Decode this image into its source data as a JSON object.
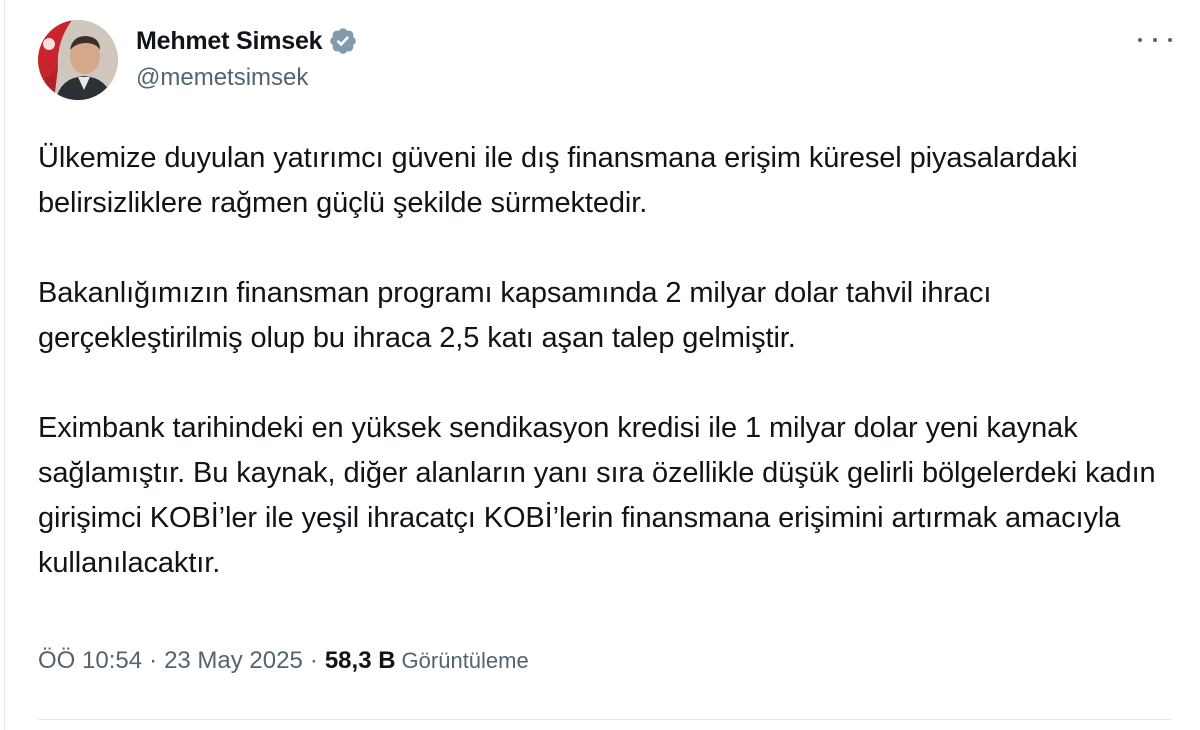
{
  "author": {
    "display_name": "Mehmet Simsek",
    "handle": "@memetsimsek",
    "verified": true,
    "avatar_icon": "profile-photo"
  },
  "more_icon": "more-horizontal-icon",
  "tweet": {
    "paragraphs": [
      "Ülkemize duyulan yatırımcı güveni ile dış finansmana erişim küresel piyasalardaki belirsizliklere rağmen güçlü şekilde sürmektedir.",
      "Bakanlığımızın finansman programı kapsamında 2 milyar dolar tahvil ihracı gerçekleştirilmiş olup bu ihraca 2,5 katı aşan talep gelmiştir.",
      "Eximbank tarihindeki en yüksek sendikasyon kredisi ile 1 milyar dolar yeni kaynak sağlamıştır. Bu kaynak, diğer alanların yanı sıra özellikle düşük gelirli bölgelerdeki kadın girişimci KOBİ’ler ile yeşil ihracatçı KOBİ’lerin finansmana erişimini artırmak amacıyla kullanılacaktır."
    ]
  },
  "meta": {
    "time": "ÖÖ 10:54",
    "separator": "·",
    "date": "23 May 2025",
    "views_count": "58,3 B",
    "views_label": "Görüntüleme"
  },
  "colors": {
    "text": "#0f1419",
    "secondary": "#536471",
    "verified_badge": "#829aab",
    "divider": "#e6e9ec"
  }
}
